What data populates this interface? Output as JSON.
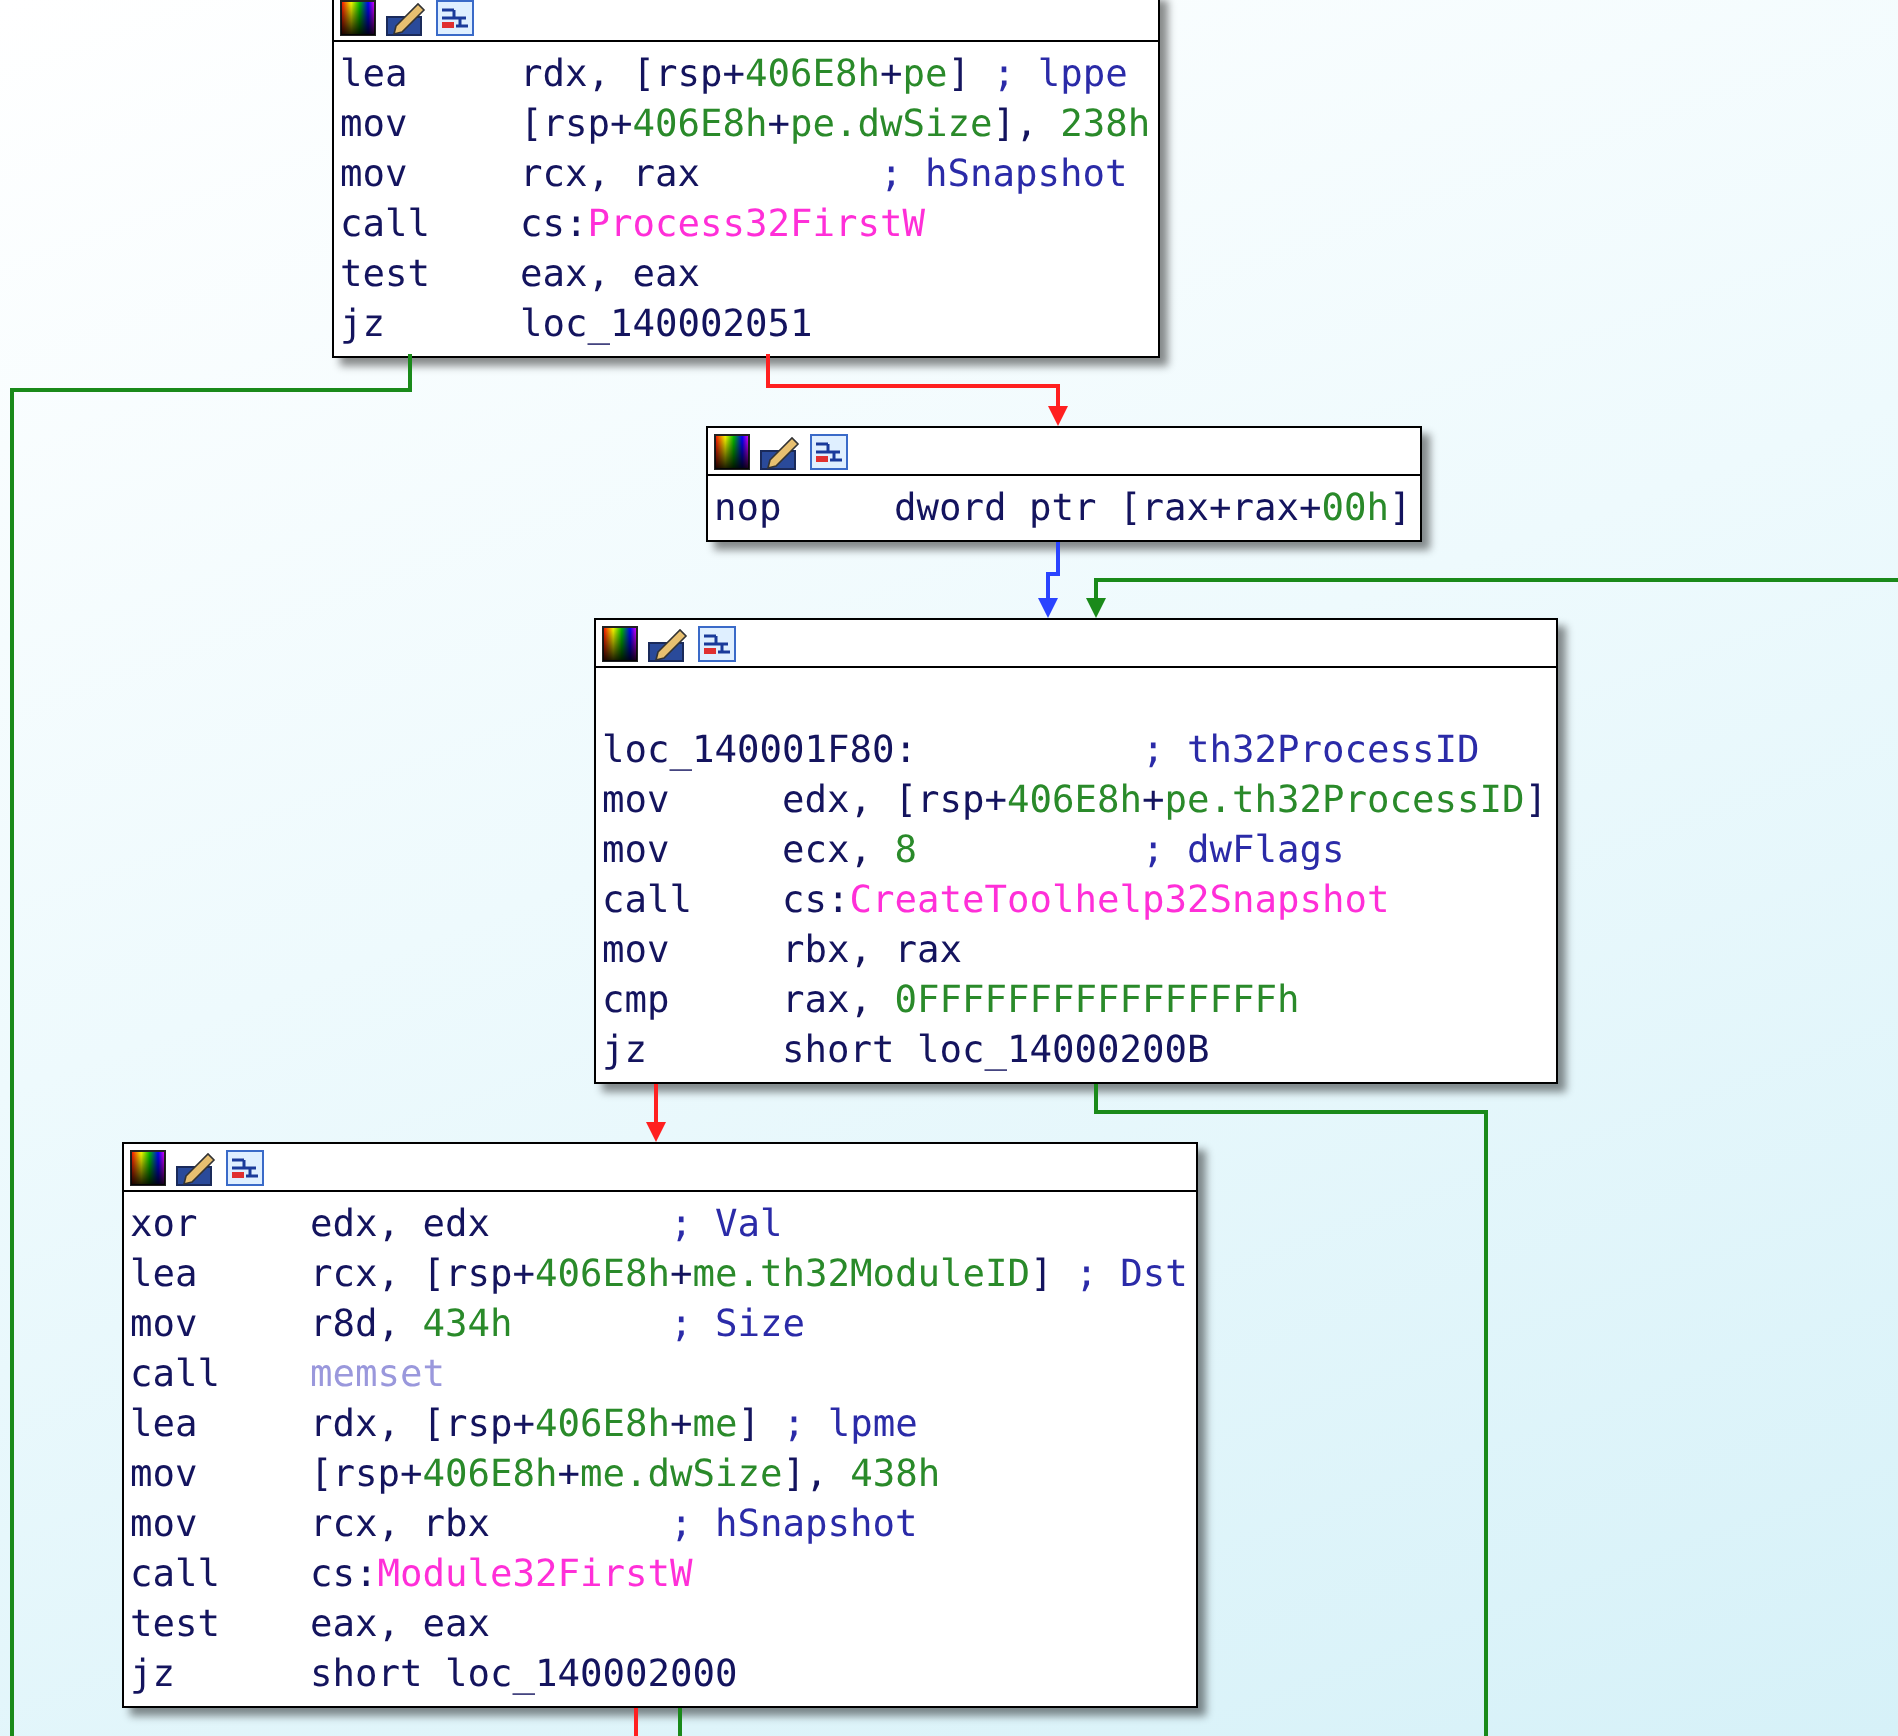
{
  "blocks": [
    {
      "lines": [
        {
          "kind": "instr",
          "mnemonic": "lea",
          "operand": [
            {
              "kind": "text",
              "text": "rdx, [rsp+"
            },
            {
              "kind": "num",
              "text": "406E8h"
            },
            {
              "kind": "text",
              "text": "+"
            },
            {
              "kind": "num",
              "text": "pe"
            },
            {
              "kind": "text",
              "text": "]"
            }
          ],
          "comment": "; lppe"
        },
        {
          "kind": "instr",
          "mnemonic": "mov",
          "operand": [
            {
              "kind": "text",
              "text": "[rsp+"
            },
            {
              "kind": "num",
              "text": "406E8h"
            },
            {
              "kind": "text",
              "text": "+"
            },
            {
              "kind": "num",
              "text": "pe.dwSize"
            },
            {
              "kind": "text",
              "text": "], "
            },
            {
              "kind": "num",
              "text": "238h"
            }
          ]
        },
        {
          "kind": "instr",
          "mnemonic": "mov",
          "operand": [
            {
              "kind": "text",
              "text": "rcx, rax"
            }
          ],
          "comment": "; hSnapshot"
        },
        {
          "kind": "instr",
          "mnemonic": "call",
          "operand": [
            {
              "kind": "text",
              "text": "cs:"
            },
            {
              "kind": "import",
              "text": "Process32FirstW"
            }
          ]
        },
        {
          "kind": "instr",
          "mnemonic": "test",
          "operand": [
            {
              "kind": "text",
              "text": "eax, eax"
            }
          ]
        },
        {
          "kind": "instr",
          "mnemonic": "jz",
          "operand": [
            {
              "kind": "text",
              "text": "loc_140002051"
            }
          ]
        }
      ]
    },
    {
      "lines": [
        {
          "kind": "instr",
          "mnemonic": "nop",
          "operand": [
            {
              "kind": "text",
              "text": "dword ptr [rax+rax+"
            },
            {
              "kind": "num",
              "text": "00h"
            },
            {
              "kind": "text",
              "text": "]"
            }
          ]
        }
      ]
    },
    {
      "lines": [
        {
          "kind": "label",
          "label": "loc_140001F80:",
          "comment": "; th32ProcessID"
        },
        {
          "kind": "instr",
          "mnemonic": "mov",
          "operand": [
            {
              "kind": "text",
              "text": "edx, [rsp+"
            },
            {
              "kind": "num",
              "text": "406E8h"
            },
            {
              "kind": "text",
              "text": "+"
            },
            {
              "kind": "num",
              "text": "pe.th32ProcessID"
            },
            {
              "kind": "text",
              "text": "]"
            }
          ]
        },
        {
          "kind": "instr",
          "mnemonic": "mov",
          "operand": [
            {
              "kind": "text",
              "text": "ecx, "
            },
            {
              "kind": "num",
              "text": "8"
            }
          ],
          "comment": "; dwFlags"
        },
        {
          "kind": "instr",
          "mnemonic": "call",
          "operand": [
            {
              "kind": "text",
              "text": "cs:"
            },
            {
              "kind": "import",
              "text": "CreateToolhelp32Snapshot"
            }
          ]
        },
        {
          "kind": "instr",
          "mnemonic": "mov",
          "operand": [
            {
              "kind": "text",
              "text": "rbx, rax"
            }
          ]
        },
        {
          "kind": "instr",
          "mnemonic": "cmp",
          "operand": [
            {
              "kind": "text",
              "text": "rax, "
            },
            {
              "kind": "num",
              "text": "0FFFFFFFFFFFFFFFFh"
            }
          ]
        },
        {
          "kind": "instr",
          "mnemonic": "jz",
          "operand": [
            {
              "kind": "text",
              "text": "short loc_14000200B"
            }
          ]
        }
      ]
    },
    {
      "lines": [
        {
          "kind": "instr",
          "mnemonic": "xor",
          "operand": [
            {
              "kind": "text",
              "text": "edx, edx"
            }
          ],
          "comment": "; Val"
        },
        {
          "kind": "instr",
          "mnemonic": "lea",
          "operand": [
            {
              "kind": "text",
              "text": "rcx, [rsp+"
            },
            {
              "kind": "num",
              "text": "406E8h"
            },
            {
              "kind": "text",
              "text": "+"
            },
            {
              "kind": "num",
              "text": "me.th32ModuleID"
            },
            {
              "kind": "text",
              "text": "]"
            }
          ],
          "comment": "; Dst"
        },
        {
          "kind": "instr",
          "mnemonic": "mov",
          "operand": [
            {
              "kind": "text",
              "text": "r8d, "
            },
            {
              "kind": "num",
              "text": "434h"
            }
          ],
          "comment": "; Size"
        },
        {
          "kind": "instr",
          "mnemonic": "call",
          "operand": [
            {
              "kind": "func",
              "text": "memset"
            }
          ]
        },
        {
          "kind": "instr",
          "mnemonic": "lea",
          "operand": [
            {
              "kind": "text",
              "text": "rdx, [rsp+"
            },
            {
              "kind": "num",
              "text": "406E8h"
            },
            {
              "kind": "text",
              "text": "+"
            },
            {
              "kind": "num",
              "text": "me"
            },
            {
              "kind": "text",
              "text": "]"
            }
          ],
          "comment": "; lpme"
        },
        {
          "kind": "instr",
          "mnemonic": "mov",
          "operand": [
            {
              "kind": "text",
              "text": "[rsp+"
            },
            {
              "kind": "num",
              "text": "406E8h"
            },
            {
              "kind": "text",
              "text": "+"
            },
            {
              "kind": "num",
              "text": "me.dwSize"
            },
            {
              "kind": "text",
              "text": "], "
            },
            {
              "kind": "num",
              "text": "438h"
            }
          ]
        },
        {
          "kind": "instr",
          "mnemonic": "mov",
          "operand": [
            {
              "kind": "text",
              "text": "rcx, rbx"
            }
          ],
          "comment": "; hSnapshot"
        },
        {
          "kind": "instr",
          "mnemonic": "call",
          "operand": [
            {
              "kind": "text",
              "text": "cs:"
            },
            {
              "kind": "import",
              "text": "Module32FirstW"
            }
          ]
        },
        {
          "kind": "instr",
          "mnemonic": "test",
          "operand": [
            {
              "kind": "text",
              "text": "eax, eax"
            }
          ]
        },
        {
          "kind": "instr",
          "mnemonic": "jz",
          "operand": [
            {
              "kind": "text",
              "text": "short loc_140002000"
            }
          ]
        }
      ]
    }
  ],
  "edges": [
    {
      "color": "#ff2020"
    },
    {
      "color": "#1a8a1a"
    },
    {
      "color": "#2a44ff"
    },
    {
      "color": "#1a8a1a"
    },
    {
      "color": "#ff2020"
    },
    {
      "color": "#1a8a1a"
    },
    {
      "color": "#ff2020"
    },
    {
      "color": "#1a8a1a"
    }
  ]
}
